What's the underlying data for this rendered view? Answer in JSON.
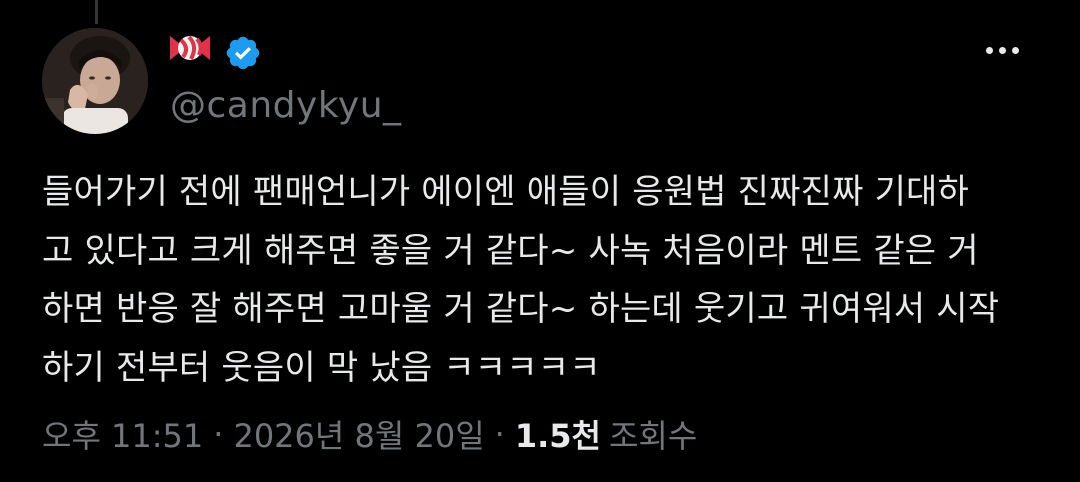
{
  "tweet": {
    "display_name_icon": "candy-emoji",
    "verified_badge_color": "#1d9bf0",
    "handle": "@candykyu_",
    "text_lines": [
      "들어가기 전에 팬매언니가 에이엔 애들이 응원법 진짜진짜 기대하",
      "고 있다고 크게 해주면 좋을 거 같다~ 사녹 처음이라 멘트 같은 거",
      "하면 반응 잘 해주면 고마울 거 같다~ 하는데 웃기고 귀여워서 시작",
      "하기 전부터 웃음이 막 났음 ㅋㅋㅋㅋㅋ"
    ],
    "time": "오후 11:51",
    "separator": "·",
    "date": "2026년 8월 20일",
    "views_count": "1.5천",
    "views_label": "조회수"
  },
  "colors": {
    "background": "#000000",
    "text_primary": "#e7e9ea",
    "text_secondary": "#71767b",
    "verified": "#1d9bf0"
  }
}
